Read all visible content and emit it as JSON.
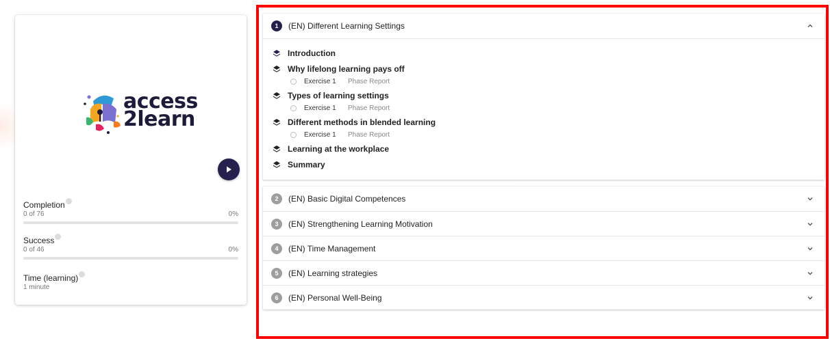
{
  "colors": {
    "brand": "#24214f",
    "highlight": "#ff0000",
    "inactive_badge": "#9e9e9e"
  },
  "course": {
    "logo": {
      "line1": "access",
      "line2": "2learn"
    },
    "play_icon": "play-icon",
    "stats": [
      {
        "label": "Completion",
        "detail": "0 of 76",
        "percent_text": "0%",
        "progress": 0
      },
      {
        "label": "Success",
        "detail": "0 of 46",
        "percent_text": "0%",
        "progress": 0
      },
      {
        "label": "Time (learning)",
        "detail": "1 minute"
      }
    ]
  },
  "sections": [
    {
      "number": "1",
      "title": "(EN) Different Learning Settings",
      "expanded": true,
      "lessons": [
        {
          "title": "Introduction"
        },
        {
          "title": "Why lifelong learning pays off",
          "exercise": "Exercise 1",
          "report": "Phase Report"
        },
        {
          "title": "Types of learning settings",
          "exercise": "Exercise 1",
          "report": "Phase Report"
        },
        {
          "title": "Different methods in blended learning",
          "exercise": "Exercise 1",
          "report": "Phase Report"
        },
        {
          "title": "Learning at the workplace"
        },
        {
          "title": "Summary"
        }
      ]
    },
    {
      "number": "2",
      "title": "(EN) Basic Digital Competences",
      "expanded": false
    },
    {
      "number": "3",
      "title": "(EN) Strengthening Learning Motivation",
      "expanded": false
    },
    {
      "number": "4",
      "title": "(EN) Time Management",
      "expanded": false
    },
    {
      "number": "5",
      "title": "(EN) Learning strategies",
      "expanded": false
    },
    {
      "number": "6",
      "title": "(EN) Personal Well-Being",
      "expanded": false
    }
  ]
}
